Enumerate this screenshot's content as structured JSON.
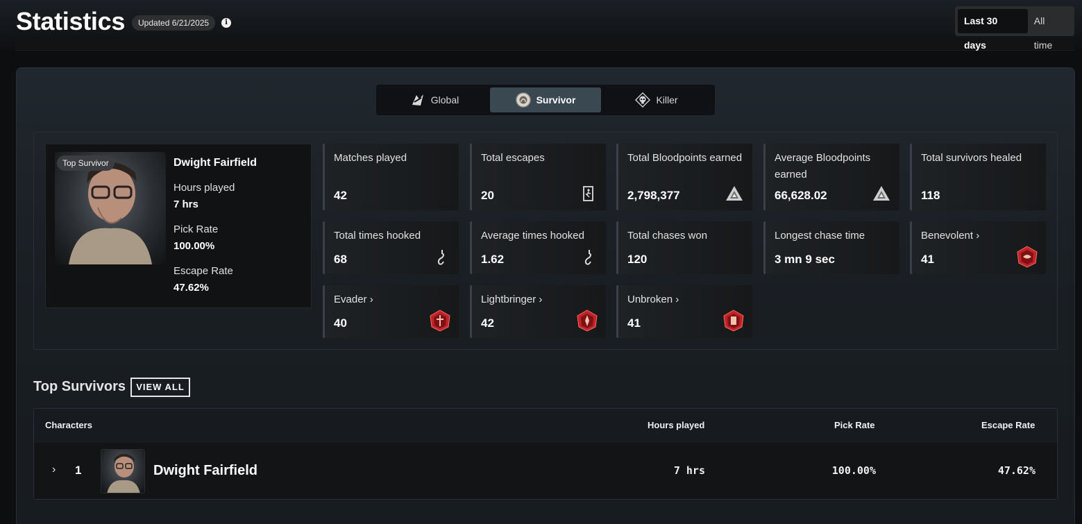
{
  "header": {
    "title": "Statistics",
    "updated": "Updated 6/21/2025",
    "range_options": [
      "Last 30 days",
      "All time"
    ],
    "active_range": "Last 30 days"
  },
  "role_tabs": [
    {
      "label": "Global",
      "icon": "global-icon"
    },
    {
      "label": "Survivor",
      "icon": "survivor-icon"
    },
    {
      "label": "Killer",
      "icon": "killer-icon"
    }
  ],
  "active_role": "Survivor",
  "top_character": {
    "badge": "Top Survivor",
    "name": "Dwight Fairfield",
    "hours_label": "Hours played",
    "hours_value": "7 hrs",
    "pick_label": "Pick Rate",
    "pick_value": "100.00%",
    "escape_label": "Escape Rate",
    "escape_value": "47.62%"
  },
  "stats": [
    {
      "label": "Matches played",
      "value": "42"
    },
    {
      "label": "Total escapes",
      "value": "20",
      "icon": "exit-door-icon"
    },
    {
      "label": "Total Bloodpoints earned",
      "value": "2,798,377",
      "icon": "bloodpoints-icon"
    },
    {
      "label": "Average Bloodpoints earned",
      "value": "66,628.02",
      "icon": "bloodpoints-icon"
    },
    {
      "label": "Total survivors healed",
      "value": "118"
    },
    {
      "label": "Total times hooked",
      "value": "68",
      "icon": "hook-icon"
    },
    {
      "label": "Average times hooked",
      "value": "1.62",
      "icon": "hook-icon"
    },
    {
      "label": "Total chases won",
      "value": "120"
    },
    {
      "label": "Longest chase time",
      "value": "3 mn 9 sec"
    },
    {
      "label": "Benevolent ›",
      "value": "41",
      "icon": "emblem-icon"
    },
    {
      "label": "Evader ›",
      "value": "40",
      "icon": "emblem-icon"
    },
    {
      "label": "Lightbringer ›",
      "value": "42",
      "icon": "emblem-icon"
    },
    {
      "label": "Unbroken ›",
      "value": "41",
      "icon": "emblem-icon"
    }
  ],
  "top_survivors": {
    "title": "Top Survivors",
    "view_all": "VIEW ALL",
    "columns": [
      "Characters",
      "Hours played",
      "Pick Rate",
      "Escape Rate"
    ],
    "rows": [
      {
        "rank": "1",
        "name": "Dwight Fairfield",
        "hours": "7 hrs",
        "pick_rate": "100.00%",
        "escape_rate": "47.62%"
      }
    ]
  },
  "colors": {
    "accent_tab": "#3a4852",
    "emblem_red": "#c0232a"
  }
}
